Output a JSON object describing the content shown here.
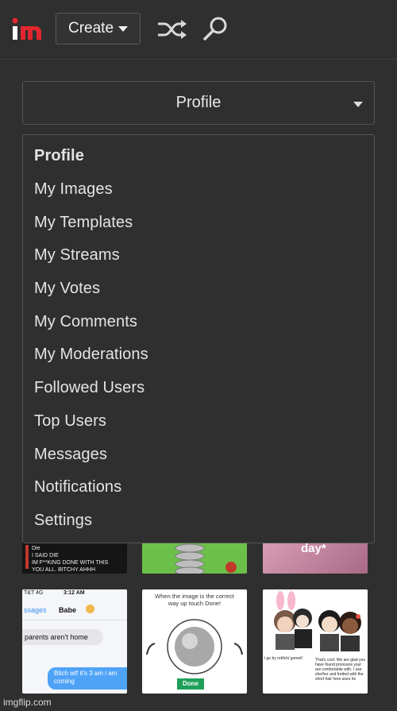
{
  "header": {
    "create_label": "Create"
  },
  "profile_select": {
    "selected": "Profile"
  },
  "menu": {
    "items": [
      {
        "label": "Profile",
        "selected": true
      },
      {
        "label": "My Images"
      },
      {
        "label": "My Templates"
      },
      {
        "label": "My Streams"
      },
      {
        "label": "My Votes"
      },
      {
        "label": "My Comments"
      },
      {
        "label": "My Moderations"
      },
      {
        "label": "Followed Users"
      },
      {
        "label": "Top Users"
      },
      {
        "label": "Messages"
      },
      {
        "label": "Notifications"
      },
      {
        "label": "Settings"
      }
    ]
  },
  "thumbnails": {
    "t1_lines": [
      "Die",
      "I SAID DIE",
      "IM F**KING DONE WITH THIS",
      "YOU ALL. BITCHY AHHH"
    ],
    "t3_text": "day*",
    "t4": {
      "status_carrier": "T&T  4G",
      "status_time": "3:12 AM",
      "back_label": "ssages",
      "contact": "Babe",
      "msg_received": "parents aren't home",
      "msg_sent": "Bitch wtf it's 3 am i am coming"
    },
    "t5": {
      "caption": "When the image is the correct way up touch Done!",
      "done_label": "Done"
    },
    "t6": {
      "left_text": "i go by rot/tch/ gorest!",
      "right_text": "That's cool. We are glad you have found pronouns your are comfortable with. I use she/her and fretted with the short hair here uses he"
    }
  },
  "watermark": "imgflip.com",
  "colors": {
    "background": "#2f2f2f",
    "border": "#555555",
    "logo_red": "#e0262e",
    "done_green": "#1fa05a",
    "sent_bubble": "#4fa3f7"
  }
}
